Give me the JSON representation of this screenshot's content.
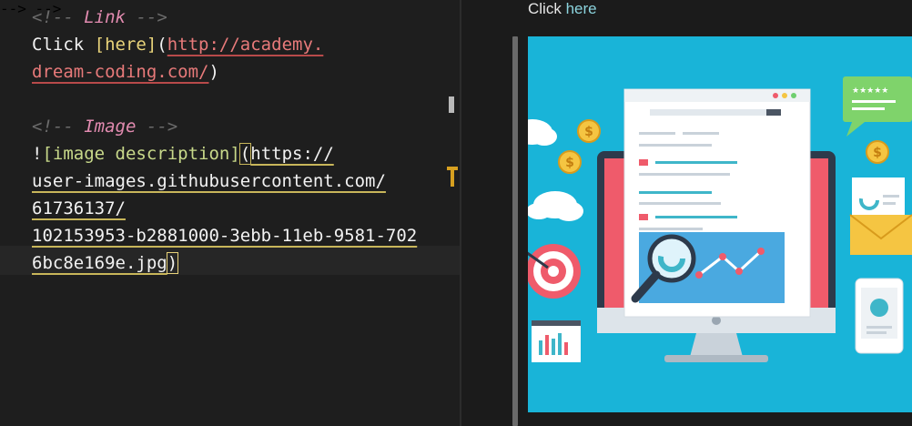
{
  "editor": {
    "link_comment_open": "<!--",
    "link_comment_label": "Link",
    "link_comment_close": "-->",
    "link_text_prefix": "Click ",
    "link_label": "[here]",
    "link_paren_open": "(",
    "link_url_line1": "http://academy.",
    "link_url_line2": "dream-coding.com/",
    "link_paren_close": ")",
    "image_comment_open": "<!--",
    "image_comment_label": "Image",
    "image_comment_close": "-->",
    "image_bang": "!",
    "image_alt": "[image description]",
    "image_paren_open": "(",
    "image_url_line1": "https://",
    "image_url_line2": "user-images.githubusercontent.com/",
    "image_url_line3": "61736137/",
    "image_url_line4": "102153953-b2881000-3ebb-11eb-9581-702",
    "image_url_line5": "6bc8e169e.jpg",
    "image_paren_close": ")"
  },
  "preview": {
    "click_prefix": "Click ",
    "link_text": "here",
    "image_alt": "image description"
  },
  "colors": {
    "editor_bg": "#1e1e1e",
    "comment": "#6b6b6b",
    "comment_label": "#e28bb0",
    "bracket": "#e8d37a",
    "link_url": "#e87a7a",
    "link_preview": "#8bd3dd",
    "illustration_bg": "#19b4d8"
  }
}
